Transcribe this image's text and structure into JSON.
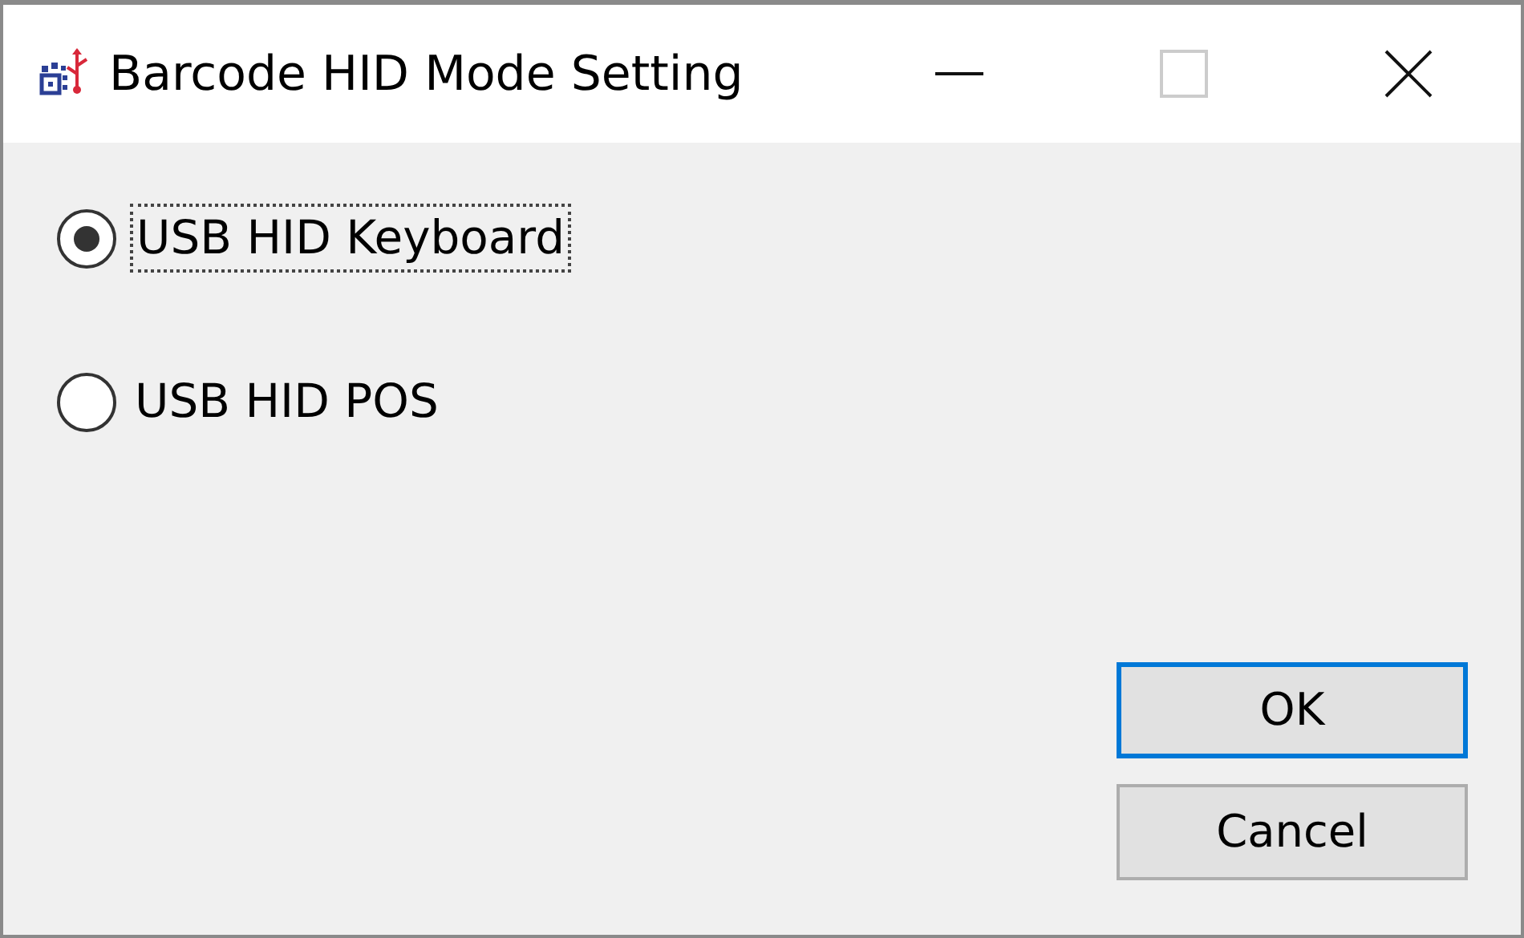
{
  "window": {
    "title": "Barcode HID Mode Setting",
    "controls": [
      {
        "kind": "minimize",
        "disabled": false
      },
      {
        "kind": "maximize",
        "disabled": true
      },
      {
        "kind": "close",
        "disabled": false
      }
    ]
  },
  "options": [
    {
      "label": "USB HID Keyboard",
      "selected": true,
      "focused": true
    },
    {
      "label": "USB HID POS",
      "selected": false,
      "focused": false
    }
  ],
  "buttons": [
    {
      "label": "OK",
      "default": true
    },
    {
      "label": "Cancel",
      "default": false
    }
  ]
}
